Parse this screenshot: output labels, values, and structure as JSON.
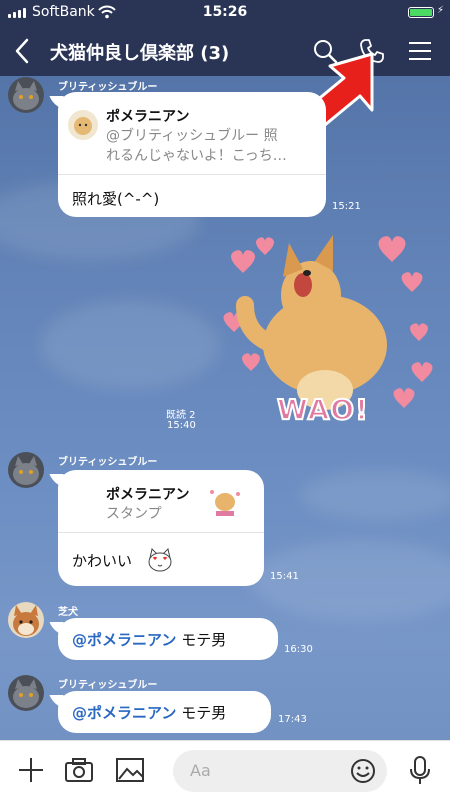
{
  "status_bar": {
    "carrier": "SoftBank",
    "time": "15:26"
  },
  "header": {
    "title": "犬猫仲良し倶楽部 (3)"
  },
  "messages": [
    {
      "sender": "ブリティッシュブルー",
      "reply_name": "ポメラニアン",
      "reply_line1": "@ブリティッシュブルー 照",
      "reply_line2": "れるんじゃないよ！こっち…",
      "text": "照れ愛(^-^)",
      "time": "15:21"
    },
    {
      "read": "既読 2",
      "time": "15:40",
      "sticker_text": "WAO!"
    },
    {
      "sender": "ブリティッシュブルー",
      "reply_name": "ポメラニアン",
      "reply_sub": "スタンプ",
      "text": "かわいい",
      "time": "15:41"
    },
    {
      "sender": "芝犬",
      "mention": "@ポメラニアン",
      "text": "モテ男",
      "time": "16:30"
    },
    {
      "sender": "ブリティッシュブルー",
      "mention": "@ポメラニアン",
      "text": "モテ男",
      "time": "17:43"
    }
  ],
  "composer": {
    "placeholder": "Aa"
  },
  "colors": {
    "header": "#2a3556",
    "accent": "#2a68c2",
    "bg": "#6384b8"
  }
}
